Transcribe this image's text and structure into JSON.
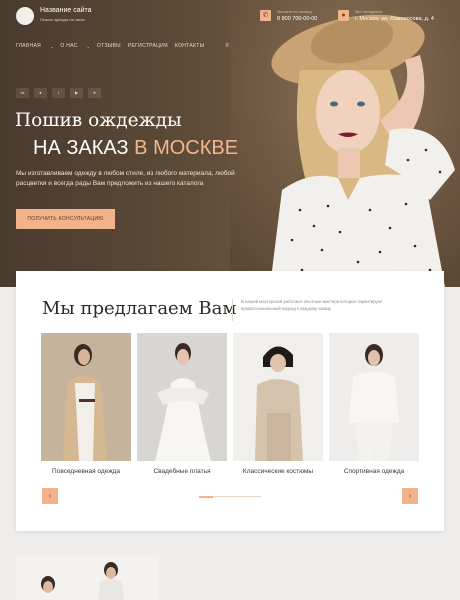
{
  "header": {
    "site_title": "Название сайта",
    "site_subtitle": "Пошив одежды на заказ",
    "phone_label": "Звоните по номеру",
    "phone_value": "8 800 700-00-00",
    "address_label": "Мы находимся",
    "address_value": "г. Москва, ул. Ломоносова, д. 4",
    "phone_icon": "phone-icon",
    "address_icon": "map-pin-icon"
  },
  "nav": {
    "items": [
      "ГЛАВНАЯ",
      "О НАС",
      "ОТЗЫВЫ",
      "РЕГИСТРАЦИЯ",
      "КОНТАКТЫ"
    ],
    "menu_icon": "hamburger-icon"
  },
  "socials": [
    "vk",
    "tw",
    "fb",
    "yt",
    "tg"
  ],
  "hero": {
    "title_line1": "Пошив ождежды",
    "title_line2_a": "НА ЗАКАЗ",
    "title_line2_b": "В МОСКВЕ",
    "description": "Мы изготавливаем одежду в любом стиле, из любого материала, любой расцветки и всегда рады Вам предложить из нашего каталога",
    "cta_label": "ПОЛУЧИТЬ КОНСУЛЬТАЦИЮ"
  },
  "offer": {
    "title": "Мы предлагаем Вам",
    "description": "В нашей мастерской работают опытные мастера которые гарантируют профессиональный подход к каждому заказу",
    "products": [
      {
        "name": "Повседневная одежда"
      },
      {
        "name": "Свадебные платья"
      },
      {
        "name": "Классические костюмы"
      },
      {
        "name": "Спортивная одежда"
      }
    ],
    "prev_icon": "chevron-left-icon",
    "next_icon": "chevron-right-icon"
  },
  "colors": {
    "accent": "#f2b38b",
    "hero_bg": "#5a4836",
    "accent_text": "#f3b88e"
  }
}
